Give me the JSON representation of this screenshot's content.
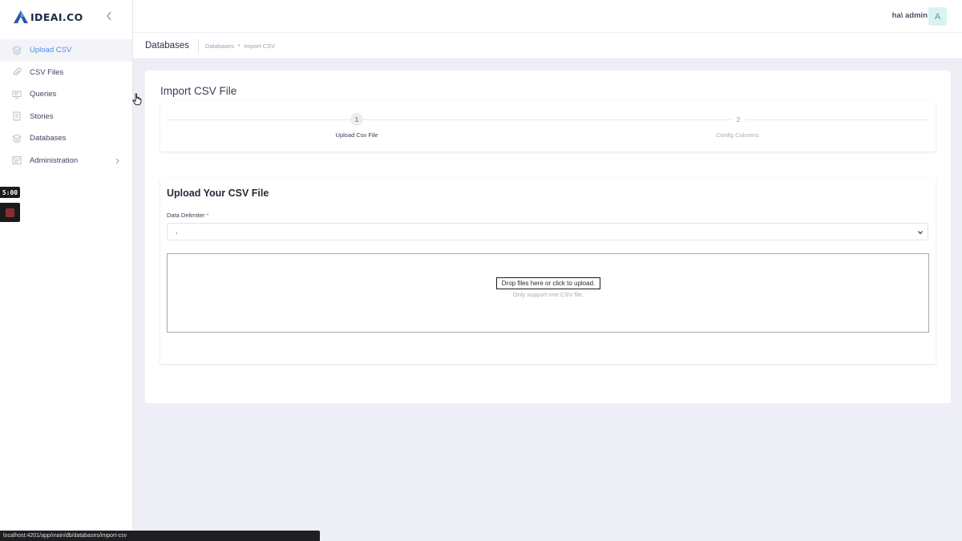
{
  "brand": {
    "name": "IDEAI.CO"
  },
  "sidebar": {
    "items": [
      {
        "label": "Upload CSV",
        "icon": "layers-icon",
        "active": true
      },
      {
        "label": "CSV Files",
        "icon": "paperclip-icon"
      },
      {
        "label": "Queries",
        "icon": "monitor-icon"
      },
      {
        "label": "Stories",
        "icon": "book-icon"
      },
      {
        "label": "Databases",
        "icon": "layers-icon"
      },
      {
        "label": "Administration",
        "icon": "admin-icon",
        "has_submenu": true
      }
    ]
  },
  "recorder": {
    "timer": "5:00"
  },
  "header": {
    "user_name": "ha\\ admin",
    "avatar_letter": "A"
  },
  "subheader": {
    "title": "Databases",
    "breadcrumb": [
      "Databases",
      "Import CSV"
    ]
  },
  "import": {
    "title": "Import CSV File",
    "steps": [
      {
        "number": "1",
        "label": "Upload Csv File",
        "current": true
      },
      {
        "number": "2",
        "label": "Config Columns",
        "current": false
      }
    ]
  },
  "upload": {
    "heading": "Upload Your CSV File",
    "delimiter_label": "Data Delimiter",
    "required_mark": "*",
    "delimiter_value": ",",
    "dropzone_message": "Drop files here or click to upload.",
    "dropzone_hint": "Only support one CSV file."
  },
  "status_bar": {
    "url": "localhost:4201/app/main/db/databases/import-csv"
  },
  "colors": {
    "accent": "#4a90e2",
    "background": "#eeeef6",
    "avatar_bg": "#d8f3f1",
    "required": "#e5484d"
  }
}
